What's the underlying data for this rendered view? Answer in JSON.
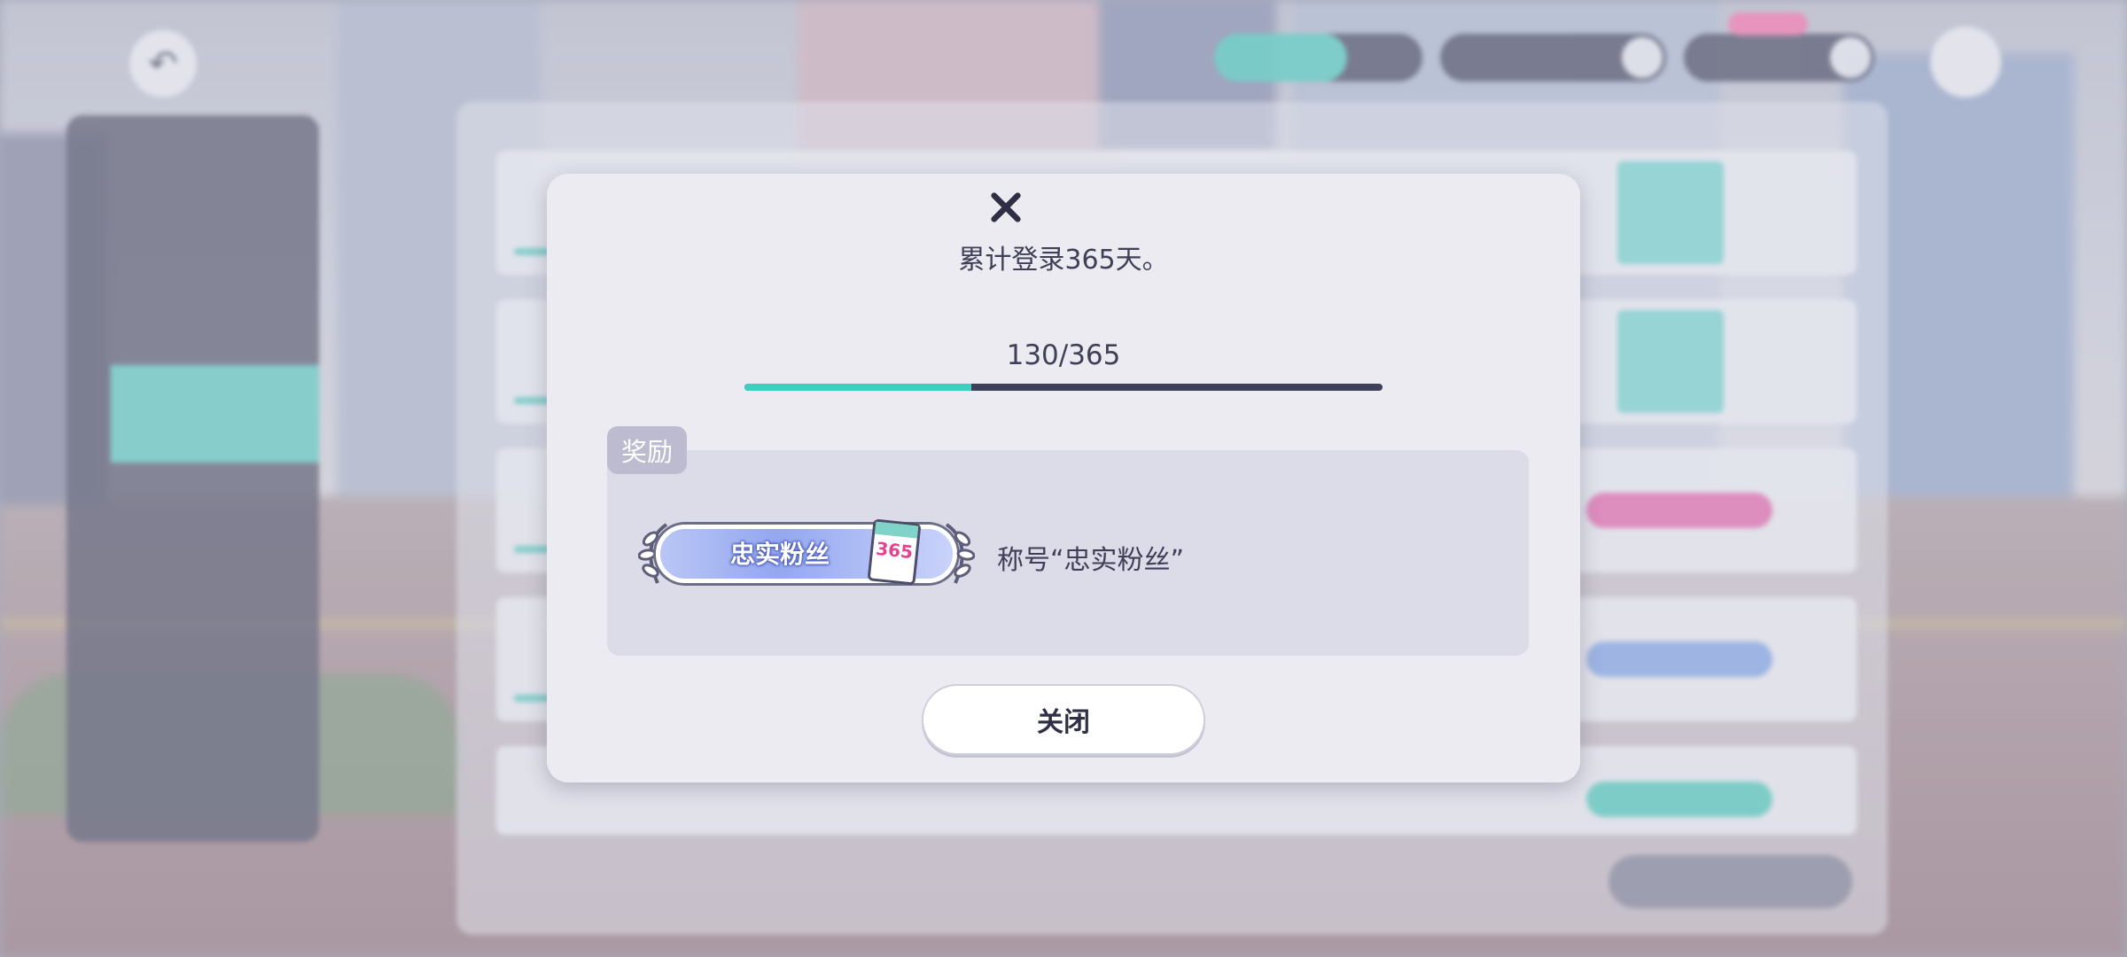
{
  "dialog": {
    "mission_text": "累计登录365天。",
    "progress": {
      "current": 130,
      "total": 365,
      "label": "130/365",
      "fraction": 0.356
    },
    "reward_tag": "奖励",
    "reward": {
      "badge_text": "忠实粉丝",
      "badge_number": "365",
      "label": "称号“忠实粉丝”"
    },
    "close_button": "关闭"
  },
  "colors": {
    "progress_fill": "#3fcfc0",
    "progress_track": "#3e3f58",
    "dialog_bg": "#ebebf1",
    "reward_box": "#dcdbe8"
  },
  "icons": {
    "back": "back-arrow-icon",
    "menu": "menu-icon",
    "close": "close-icon"
  }
}
